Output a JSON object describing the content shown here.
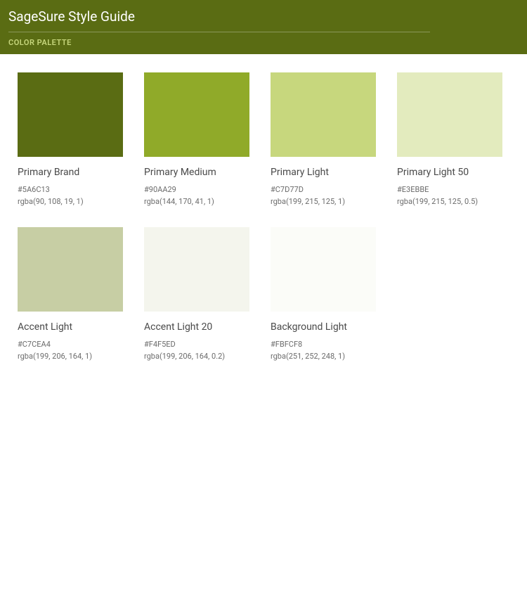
{
  "header": {
    "title": "SageSure Style Guide",
    "subtitle": "COLOR PALETTE"
  },
  "swatches": [
    {
      "name": "Primary Brand",
      "hex": "#5A6C13",
      "rgba": "rgba(90, 108, 19, 1)",
      "color": "#5A6C13"
    },
    {
      "name": "Primary Medium",
      "hex": "#90AA29",
      "rgba": "rgba(144, 170, 41, 1)",
      "color": "#90AA29"
    },
    {
      "name": "Primary Light",
      "hex": "#C7D77D",
      "rgba": "rgba(199, 215, 125, 1)",
      "color": "#C7D77D"
    },
    {
      "name": "Primary Light 50",
      "hex": "#E3EBBE",
      "rgba": "rgba(199, 215, 125, 0.5)",
      "color": "#E3EBBE"
    },
    {
      "name": "Accent Light",
      "hex": "#C7CEA4",
      "rgba": "rgba(199, 206, 164, 1)",
      "color": "#C7CEA4"
    },
    {
      "name": "Accent Light 20",
      "hex": "#F4F5ED",
      "rgba": "rgba(199, 206, 164, 0.2)",
      "color": "#F4F5ED"
    },
    {
      "name": "Background Light",
      "hex": "#FBFCF8",
      "rgba": "rgba(251, 252, 248, 1)",
      "color": "#FBFCF8"
    }
  ]
}
